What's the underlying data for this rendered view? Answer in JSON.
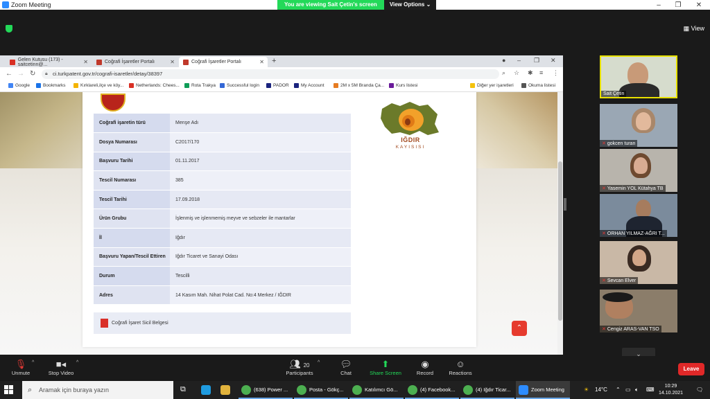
{
  "zoom": {
    "title": "Zoom Meeting",
    "share_banner": "You are viewing Sait Çetin's screen",
    "view_options": "View Options",
    "view_label": "View",
    "window_controls": [
      "–",
      "❐",
      "✕"
    ]
  },
  "browser": {
    "tabs": [
      {
        "label": "Gelen Kutusu (173) - saitcetinn@...",
        "active": false,
        "favicon_color": "#d93025"
      },
      {
        "label": "Coğrafi İşaretler Portalı",
        "active": false,
        "favicon_color": "#c0392b"
      },
      {
        "label": "Coğrafi İşaretler Portalı",
        "active": true,
        "favicon_color": "#c0392b"
      }
    ],
    "new_tab": "+",
    "url": "ci.turkpatent.gov.tr/cografi-isaretler/detay/38397",
    "bookmarks": [
      {
        "label": "Google",
        "color": "#4285f4"
      },
      {
        "label": "Bookmarks",
        "color": "#1a73e8"
      },
      {
        "label": "Kırklareli,ilçe ve köy...",
        "color": "#f4b400"
      },
      {
        "label": "Netherlands: Chees...",
        "color": "#d93025"
      },
      {
        "label": "Rota Trakya",
        "color": "#0f9d58"
      },
      {
        "label": "Successful login",
        "color": "#3367d6"
      },
      {
        "label": "PADOR",
        "color": "#1a237e"
      },
      {
        "label": "My Account",
        "color": "#1a237e"
      },
      {
        "label": "2M x 5M Branda Ça...",
        "color": "#e67c22"
      },
      {
        "label": "Kurs listesi",
        "color": "#6a1b9a"
      }
    ],
    "bookmarks_right": [
      "Diğer yer işaretleri",
      "Okuma listesi"
    ]
  },
  "record": {
    "rows": [
      {
        "key": "Coğrafi işaretin türü",
        "value": "Menşe Adı"
      },
      {
        "key": "Dosya Numarası",
        "value": "C2017/170"
      },
      {
        "key": "Başvuru Tarihi",
        "value": "01.11.2017"
      },
      {
        "key": "Tescil Numarası",
        "value": "385"
      },
      {
        "key": "Tescil Tarihi",
        "value": "17.09.2018"
      },
      {
        "key": "Ürün Grubu",
        "value": "İşlenmiş ve işlenmemiş meyve ve sebzeler ile mantarlar"
      },
      {
        "key": "İl",
        "value": "Iğdır"
      },
      {
        "key": "Başvuru Yapan/Tescil Ettiren",
        "value": "Iğdır Ticaret ve Sanayi Odası"
      },
      {
        "key": "Durum",
        "value": "Tescilli"
      },
      {
        "key": "Adres",
        "value": "14 Kasım Mah. Nihat Polat Cad. No:4 Merkez / IĞDIR"
      }
    ],
    "document_link": "Coğrafi İşaret Sicil Belgesi"
  },
  "logo": {
    "line1": "IĞDIR",
    "line2": "KAYISISI"
  },
  "participants": [
    {
      "name": "Sait Çetin",
      "muted": false,
      "speaking": true,
      "bg": "#cfd8c8",
      "skin": "#c89a78"
    },
    {
      "name": "gokcen turan",
      "muted": true,
      "speaking": false,
      "bg": "#9aa7b4",
      "skin": "#e2b99c"
    },
    {
      "name": "Yasemin YOL Kütahya TB",
      "muted": true,
      "speaking": false,
      "bg": "#b8b4ac",
      "skin": "#d9ac92"
    },
    {
      "name": "ORHAN YILMAZ-AĞRI T...",
      "muted": true,
      "speaking": false,
      "bg": "#7b8b9c",
      "skin": "#a67c5e"
    },
    {
      "name": "Sevcan Elver",
      "muted": true,
      "speaking": false,
      "bg": "#c9b8a6",
      "skin": "#d3a688"
    },
    {
      "name": "Cengiz ARAS-VAN TSO",
      "muted": true,
      "speaking": false,
      "bg": "#8b7d6a",
      "skin": "#b08060"
    }
  ],
  "toolbar": {
    "unmute": "Unmute",
    "stop_video": "Stop Video",
    "participants": "Participants",
    "participants_count": "20",
    "chat": "Chat",
    "share_screen": "Share Screen",
    "record": "Record",
    "reactions": "Reactions",
    "leave": "Leave"
  },
  "taskbar": {
    "search_placeholder": "Aramak için buraya yazın",
    "apps": [
      {
        "label": "(638) Power ...",
        "color": "#4caf50"
      },
      {
        "label": "Posta - Gökç...",
        "color": "#4caf50"
      },
      {
        "label": "Katılımcı Gö...",
        "color": "#4caf50"
      },
      {
        "label": "(4) Facebook...",
        "color": "#4caf50"
      },
      {
        "label": "(4) Iğdır Ticar...",
        "color": "#4caf50"
      },
      {
        "label": "Zoom Meeting",
        "color": "#2d8cff"
      }
    ],
    "weather": "14°C",
    "time": "10:29",
    "date": "14.10.2021"
  }
}
